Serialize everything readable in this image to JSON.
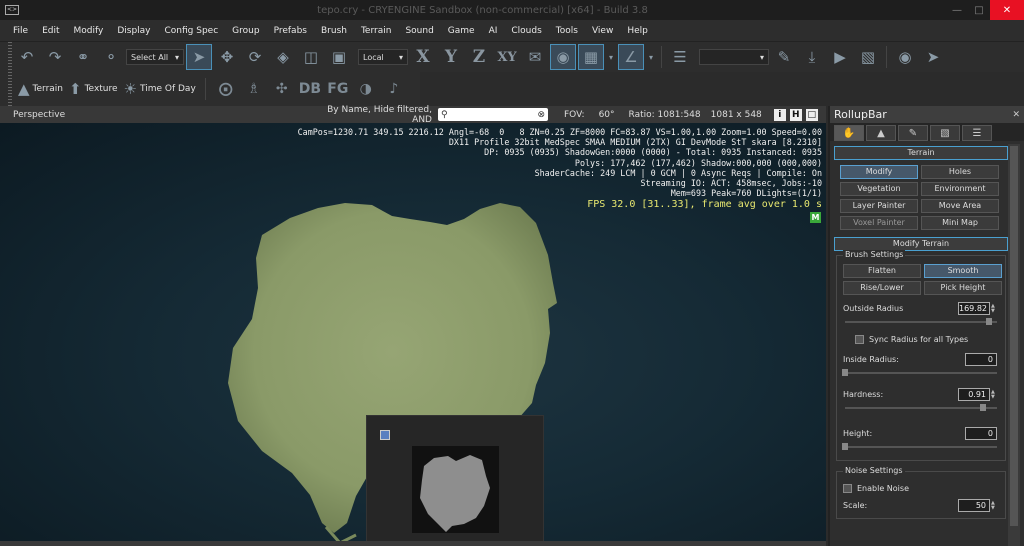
{
  "titlebar": {
    "title": "tepo.cry - CRYENGINE Sandbox (non-commercial) [x64] - Build 3.8"
  },
  "menu": [
    "File",
    "Edit",
    "Modify",
    "Display",
    "Config Spec",
    "Group",
    "Prefabs",
    "Brush",
    "Terrain",
    "Sound",
    "Game",
    "AI",
    "Clouds",
    "Tools",
    "View",
    "Help"
  ],
  "toolbar": {
    "select_all": "Select All",
    "coord_space": "Local",
    "axes": {
      "x": "X",
      "y": "Y",
      "z": "Z",
      "xy": "XY"
    }
  },
  "toolbar2": {
    "terrain_label": "Terrain",
    "texture_label": "Texture",
    "time_of_day_label": "Time Of Day",
    "db_label": "DB",
    "fg_label": "FG"
  },
  "viewport_header": {
    "view_name": "Perspective",
    "filter": "By Name, Hide filtered, AND",
    "fov_label": "FOV:",
    "fov_value": "60°",
    "ratio": "Ratio: 1081:548",
    "resolution": "1081 x 548",
    "btn_i": "i",
    "btn_h": "H"
  },
  "overlay": {
    "lines": [
      "CamPos=1230.71 349.15 2216.12 Angl=-68  0   8 ZN=0.25 ZF=8000 FC=83.87 VS=1.00,1.00 Zoom=1.00 Speed=0.00",
      "DX11 Profile 32bit MedSpec SMAA MEDIUM (2TX) GI DevMode StT skara [8.2310]",
      "DP: 0935 (0935) ShadowGen:0000 (0000) - Total: 0935 Instanced: 0935",
      "Polys: 177,462 (177,462) Shadow:000,000 (000,000)",
      "ShaderCache: 249 LCM | 0 GCM | 0 Async Reqs | Compile: On",
      "Streaming IO: ACT: 458msec, Jobs:-10",
      "Mem=693 Peak=760 DLights=(1/1)"
    ],
    "fps": "FPS 32.0 [31..33], frame avg over 1.0 s",
    "m_badge": "M"
  },
  "rollup": {
    "title": "RollupBar",
    "terrain_section": "Terrain",
    "terrain_buttons": [
      "Modify",
      "Holes",
      "Vegetation",
      "Environment",
      "Layer Painter",
      "Move Area",
      "Voxel Painter",
      "Mini Map"
    ],
    "modify_section": "Modify Terrain",
    "brush_settings": "Brush Settings",
    "brush_buttons": [
      "Flatten",
      "Smooth",
      "Rise/Lower",
      "Pick Height"
    ],
    "outside_radius_label": "Outside Radius",
    "outside_radius": "169.82",
    "outside_radius_level": 0.95,
    "sync_radius": "Sync Radius for all Types",
    "inside_radius_label": "Inside Radius:",
    "inside_radius": "0",
    "hardness_label": "Hardness:",
    "hardness": "0.91",
    "height_label": "Height:",
    "height": "0",
    "noise_settings": "Noise Settings",
    "enable_noise": "Enable Noise",
    "scale_label": "Scale:",
    "scale": "50"
  },
  "colors": {
    "accent": "#4a90b8",
    "terrain": "#8a9a68",
    "fps": "#e8e870",
    "close": "#e81123"
  }
}
